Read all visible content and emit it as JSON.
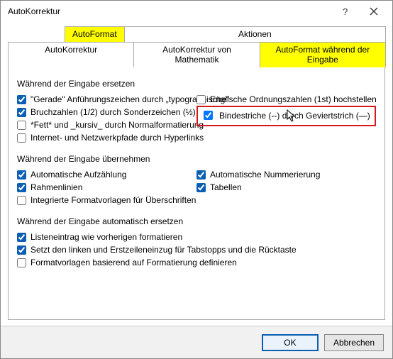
{
  "window": {
    "title": "AutoKorrektur"
  },
  "tabs": {
    "autoformat": "AutoFormat",
    "aktionen": "Aktionen",
    "autokorrektur": "AutoKorrektur",
    "autokorrektur_math": "AutoKorrektur von Mathematik",
    "autoformat_eingabe": "AutoFormat während der Eingabe"
  },
  "groups": {
    "replace": "Während der Eingabe ersetzen",
    "apply": "Während der Eingabe übernehmen",
    "auto": "Während der Eingabe automatisch ersetzen"
  },
  "options": {
    "quotes": "\"Gerade\" Anführungszeichen durch „typographische\"",
    "fractions": "Bruchzahlen (1/2) durch Sonderzeichen (½)",
    "bold_italic": "*Fett* und _kursiv_ durch Normalformatierung",
    "hyperlinks": "Internet- und Netzwerkpfade durch Hyperlinks",
    "ordinals": "Englische Ordnungszahlen (1st) hochstellen",
    "hyphens": "Bindestriche (--) durch Geviertstrich (—)",
    "bullets": "Automatische Aufzählung",
    "borders": "Rahmenlinien",
    "styles": "Integrierte Formatvorlagen für Überschriften",
    "numbering": "Automatische Nummerierung",
    "tables": "Tabellen",
    "list_format": "Listeneintrag wie vorherigen formatieren",
    "indent": "Setzt den linken und Erstzeileneinzug für Tabstopps und die Rücktaste",
    "define_styles": "Formatvorlagen basierend auf Formatierung definieren"
  },
  "buttons": {
    "ok": "OK",
    "cancel": "Abbrechen"
  }
}
